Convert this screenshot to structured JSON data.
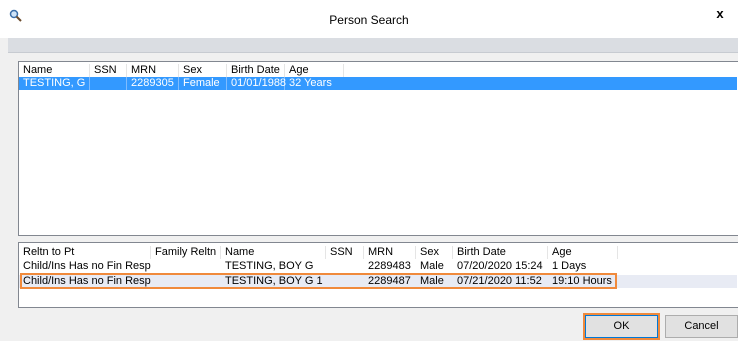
{
  "window": {
    "title": "Person Search",
    "close_label": "x"
  },
  "person_list": {
    "columns": [
      "Name",
      "SSN",
      "MRN",
      "Sex",
      "Birth Date",
      "Age"
    ],
    "rows": [
      {
        "name": "TESTING, G",
        "ssn": "",
        "mrn": "2289305",
        "sex": "Female",
        "birth_date": "01/01/1988",
        "age": "32 Years",
        "selected": true
      }
    ]
  },
  "related_list": {
    "columns": [
      "Reltn to Pt",
      "Family Reltn",
      "Name",
      "SSN",
      "MRN",
      "Sex",
      "Birth Date",
      "Age"
    ],
    "rows": [
      {
        "reltn": "Child/Ins Has no Fin Resp",
        "family": "",
        "name": "TESTING, BOY G",
        "ssn": "",
        "mrn": "2289483",
        "sex": "Male",
        "birth_date": "07/20/2020 15:24",
        "age": "1 Days"
      },
      {
        "reltn": "Child/Ins Has no Fin Resp",
        "family": "",
        "name": "TESTING, BOY G 1",
        "ssn": "",
        "mrn": "2289487",
        "sex": "Male",
        "birth_date": "07/21/2020 11:52",
        "age": "19:10 Hours"
      }
    ]
  },
  "buttons": {
    "ok": "OK",
    "cancel": "Cancel"
  },
  "colors": {
    "selection": "#3399ff",
    "highlight_outline": "#f08a3c"
  }
}
